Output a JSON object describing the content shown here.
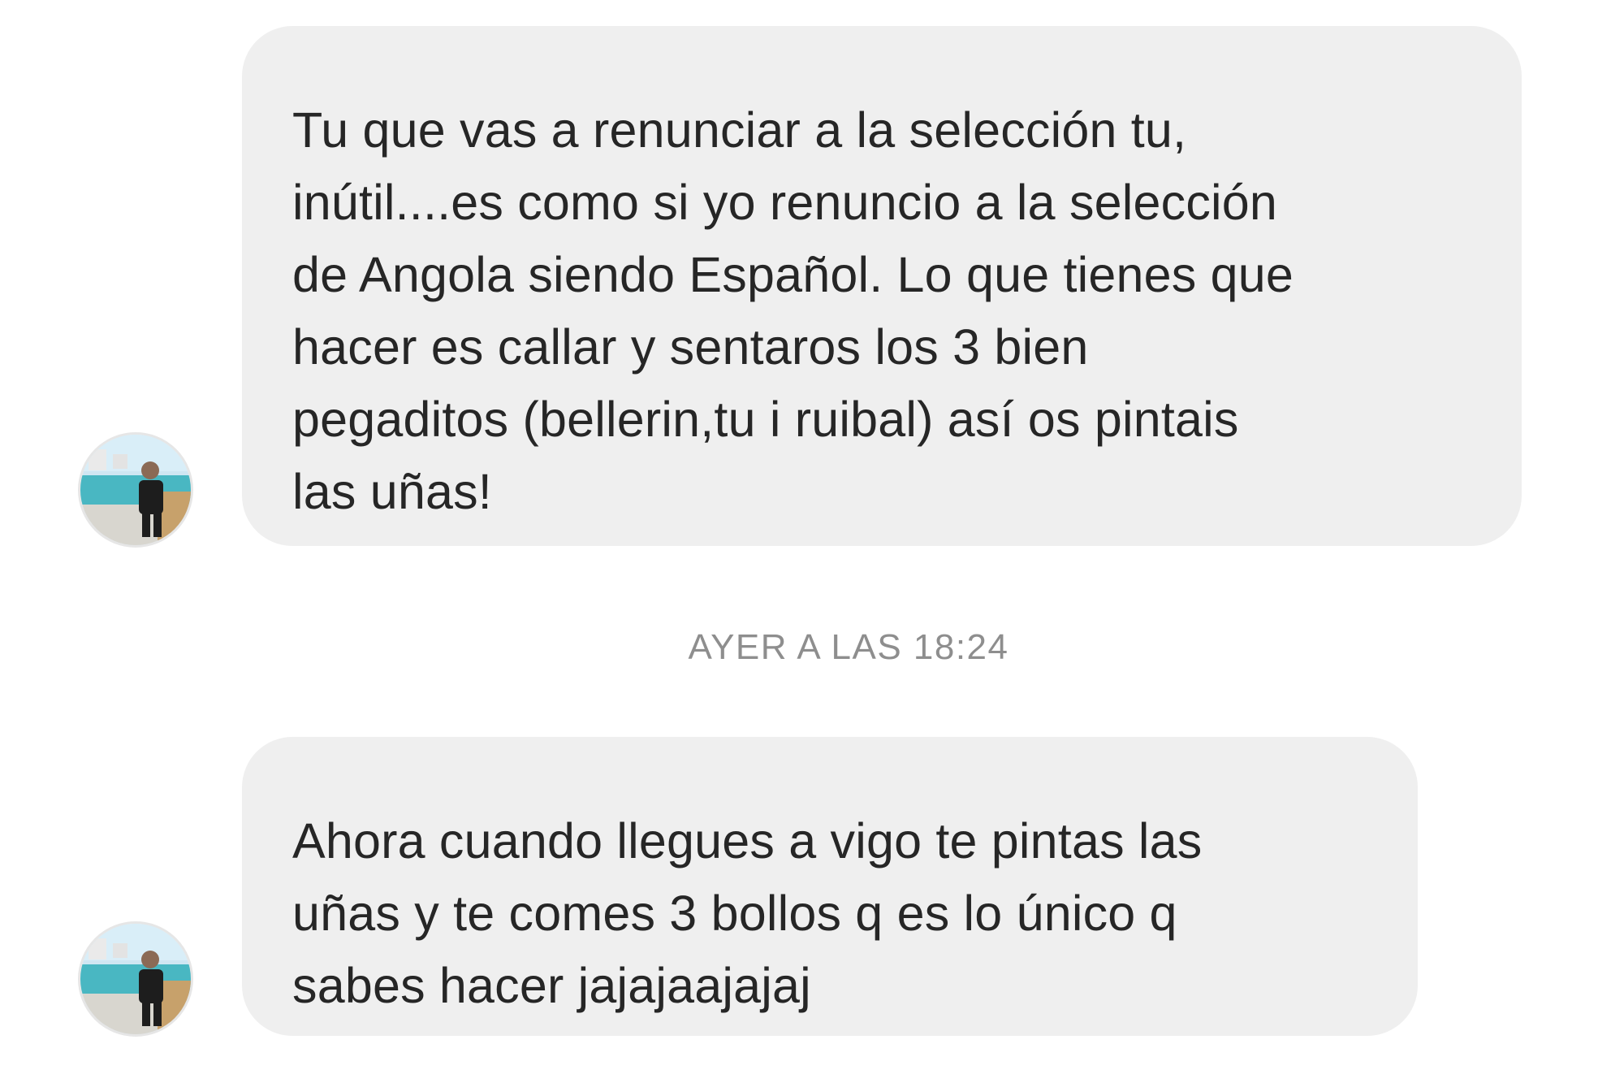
{
  "thread": {
    "messages": [
      {
        "sender": "other",
        "avatar_icon": "profile-photo-icon",
        "text": "Tu que vas a renunciar a la selección tu,\ninútil....es como si yo renuncio a la selección\nde Angola siendo Español. Lo que tienes que\nhacer es callar y sentaros los 3 bien\npegaditos (bellerin,tu i ruibal) así os pintais\nlas uñas!"
      },
      {
        "sender": "other",
        "avatar_icon": "profile-photo-icon",
        "text": "Ahora cuando llegues a vigo te pintas las\nuñas y te comes 3 bollos q es lo único q\nsabes hacer jajajaajajaj"
      }
    ],
    "timestamp_label": "AYER A LAS 18:24"
  },
  "colors": {
    "bubble_bg": "#efefef",
    "text": "#262626",
    "timestamp": "#8e8e8e",
    "background": "#ffffff"
  }
}
